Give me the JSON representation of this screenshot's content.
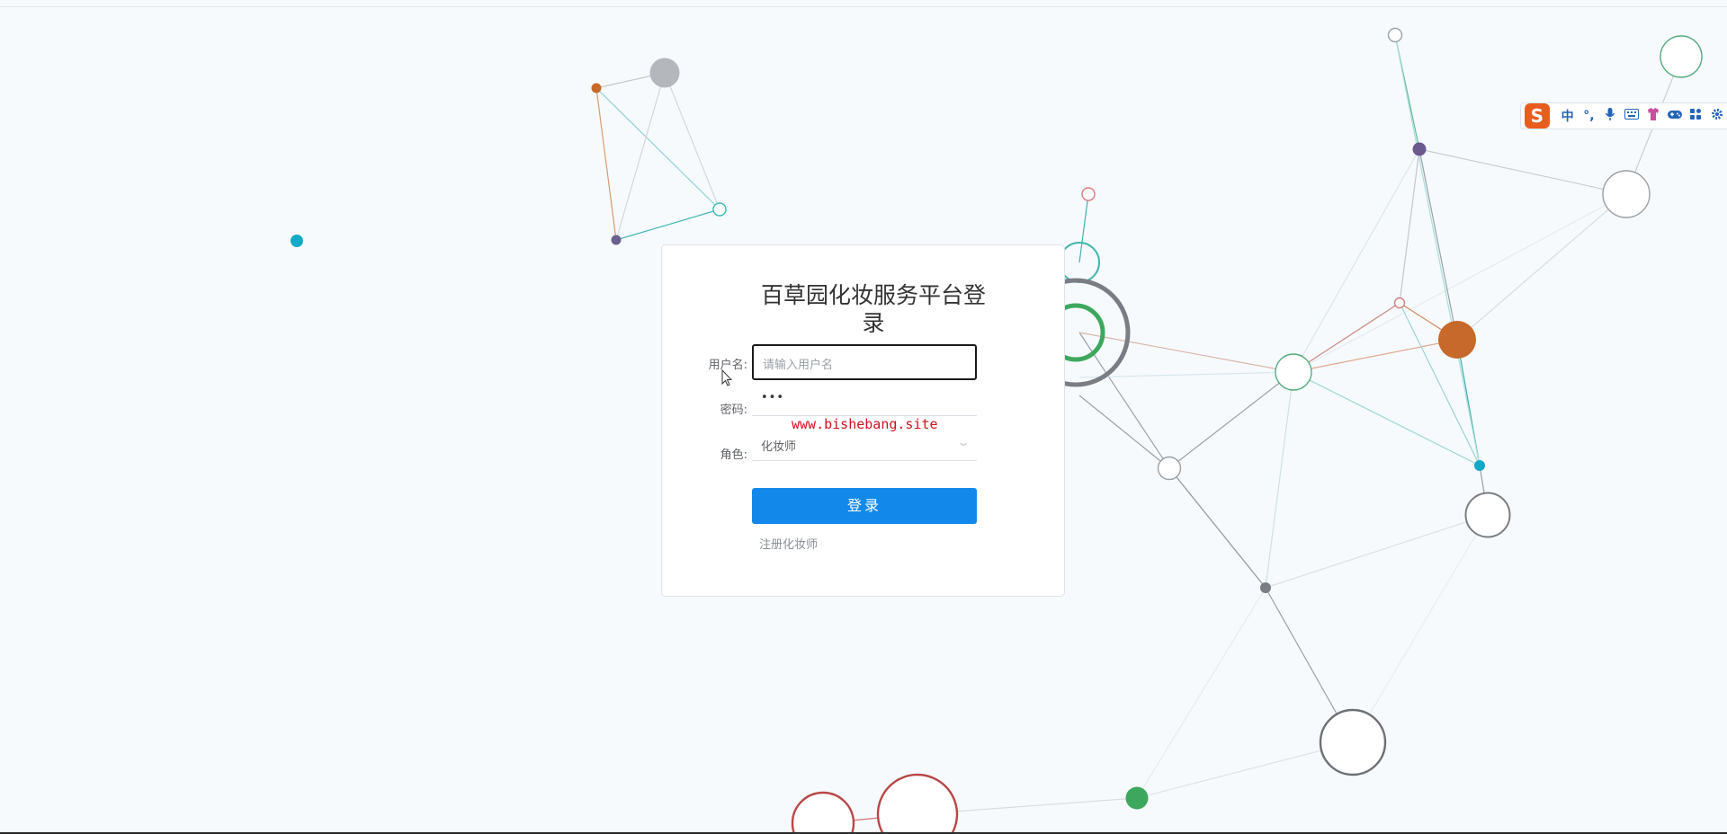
{
  "login": {
    "title": "百草园化妆服务平台登录",
    "username_label": "用户名:",
    "username_placeholder": "请输入用户名",
    "password_label": "密码:",
    "password_value": "•••",
    "role_label": "角色:",
    "role_value": "化妆师",
    "login_button": "登录",
    "register_link": "注册化妆师"
  },
  "watermark": "www.bishebang.site",
  "ime_toolbar": {
    "logo": "S",
    "items": [
      "中",
      "°,",
      "mic-icon",
      "keyboard-icon",
      "skin-icon",
      "game-icon",
      "apps-icon",
      "settings-icon"
    ]
  },
  "colors": {
    "primary_button": "#1289ea",
    "watermark": "#d0121b",
    "ime_logo": "#e85c1e"
  }
}
